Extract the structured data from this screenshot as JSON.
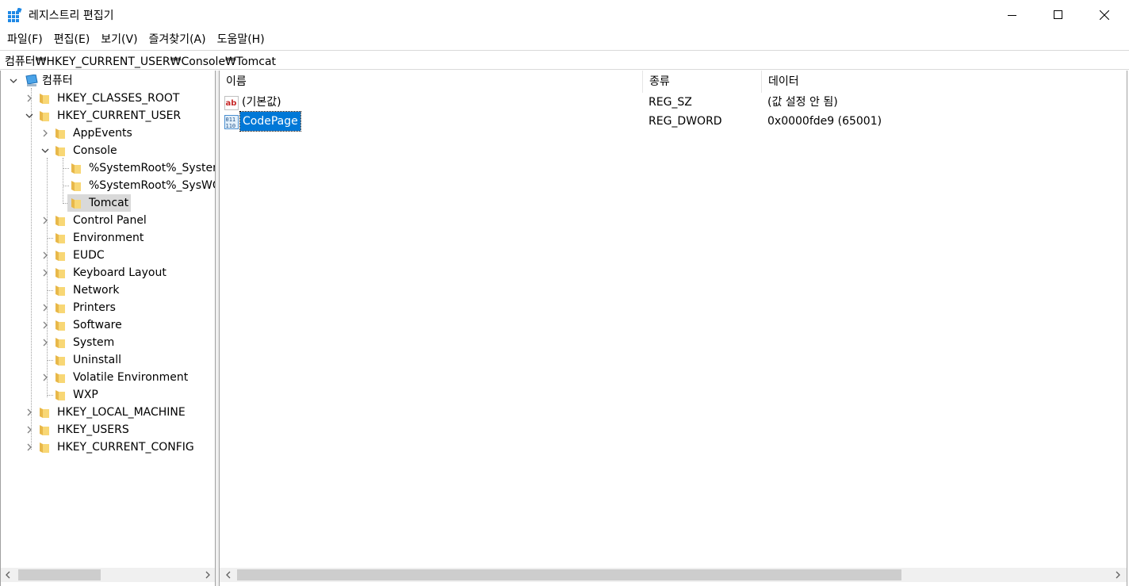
{
  "window": {
    "title": "레지스트리 편집기",
    "minimize_icon": "minimize-icon",
    "maximize_icon": "maximize-icon",
    "close_icon": "close-icon"
  },
  "menu": [
    "파일(F)",
    "편집(E)",
    "보기(V)",
    "즐겨찾기(A)",
    "도움말(H)"
  ],
  "address": "컴퓨터₩HKEY_CURRENT_USER₩Console₩Tomcat",
  "tree": {
    "root": "컴퓨터",
    "items": [
      {
        "label": "HKEY_CLASSES_ROOT"
      },
      {
        "label": "HKEY_CURRENT_USER"
      },
      {
        "label": "AppEvents"
      },
      {
        "label": "Console"
      },
      {
        "label": "%SystemRoot%_System"
      },
      {
        "label": "%SystemRoot%_SysWO"
      },
      {
        "label": "Tomcat"
      },
      {
        "label": "Control Panel"
      },
      {
        "label": "Environment"
      },
      {
        "label": "EUDC"
      },
      {
        "label": "Keyboard Layout"
      },
      {
        "label": "Network"
      },
      {
        "label": "Printers"
      },
      {
        "label": "Software"
      },
      {
        "label": "System"
      },
      {
        "label": "Uninstall"
      },
      {
        "label": "Volatile Environment"
      },
      {
        "label": "WXP"
      },
      {
        "label": "HKEY_LOCAL_MACHINE"
      },
      {
        "label": "HKEY_USERS"
      },
      {
        "label": "HKEY_CURRENT_CONFIG"
      }
    ]
  },
  "list": {
    "columns": [
      "이름",
      "종류",
      "데이터"
    ],
    "rows": [
      {
        "name": "(기본값)",
        "type": "REG_SZ",
        "data": "(값 설정 안 됨)",
        "icon": "string-value-icon"
      },
      {
        "name": "CodePage",
        "type": "REG_DWORD",
        "data": "0x0000fde9 (65001)",
        "icon": "binary-value-icon"
      }
    ]
  },
  "colors": {
    "selection": "#0078d7",
    "tree_selection": "#d9d9d9",
    "folder": "#f8d775"
  }
}
